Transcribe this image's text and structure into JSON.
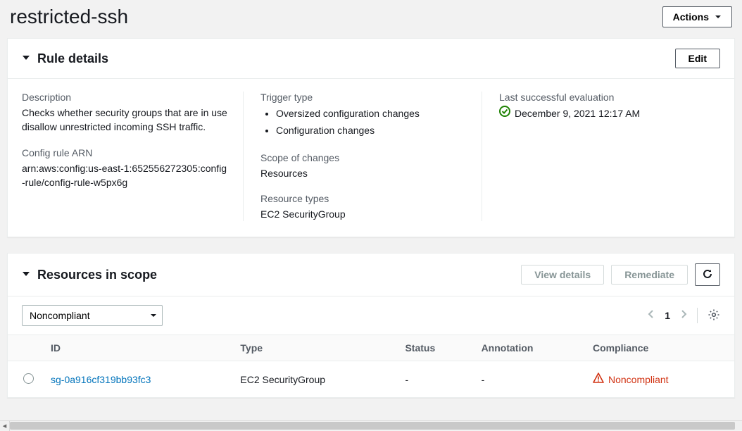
{
  "header": {
    "title": "restricted-ssh",
    "actions_label": "Actions"
  },
  "rule_details": {
    "panel_title": "Rule details",
    "edit_label": "Edit",
    "description_label": "Description",
    "description_value": "Checks whether security groups that are in use disallow unrestricted incoming SSH traffic.",
    "arn_label": "Config rule ARN",
    "arn_value": "arn:aws:config:us-east-1:652556272305:config-rule/config-rule-w5px6g",
    "trigger_label": "Trigger type",
    "trigger_items": [
      "Oversized configuration changes",
      "Configuration changes"
    ],
    "scope_label": "Scope of changes",
    "scope_value": "Resources",
    "resource_types_label": "Resource types",
    "resource_types_value": "EC2 SecurityGroup",
    "eval_label": "Last successful evaluation",
    "eval_value": "December 9, 2021 12:17 AM"
  },
  "resources": {
    "panel_title": "Resources in scope",
    "view_details_label": "View details",
    "remediate_label": "Remediate",
    "filter_selected": "Noncompliant",
    "page": "1",
    "columns": {
      "id": "ID",
      "type": "Type",
      "status": "Status",
      "annotation": "Annotation",
      "compliance": "Compliance"
    },
    "rows": [
      {
        "id": "sg-0a916cf319bb93fc3",
        "type": "EC2 SecurityGroup",
        "status": "-",
        "annotation": "-",
        "compliance": "Noncompliant"
      }
    ]
  }
}
